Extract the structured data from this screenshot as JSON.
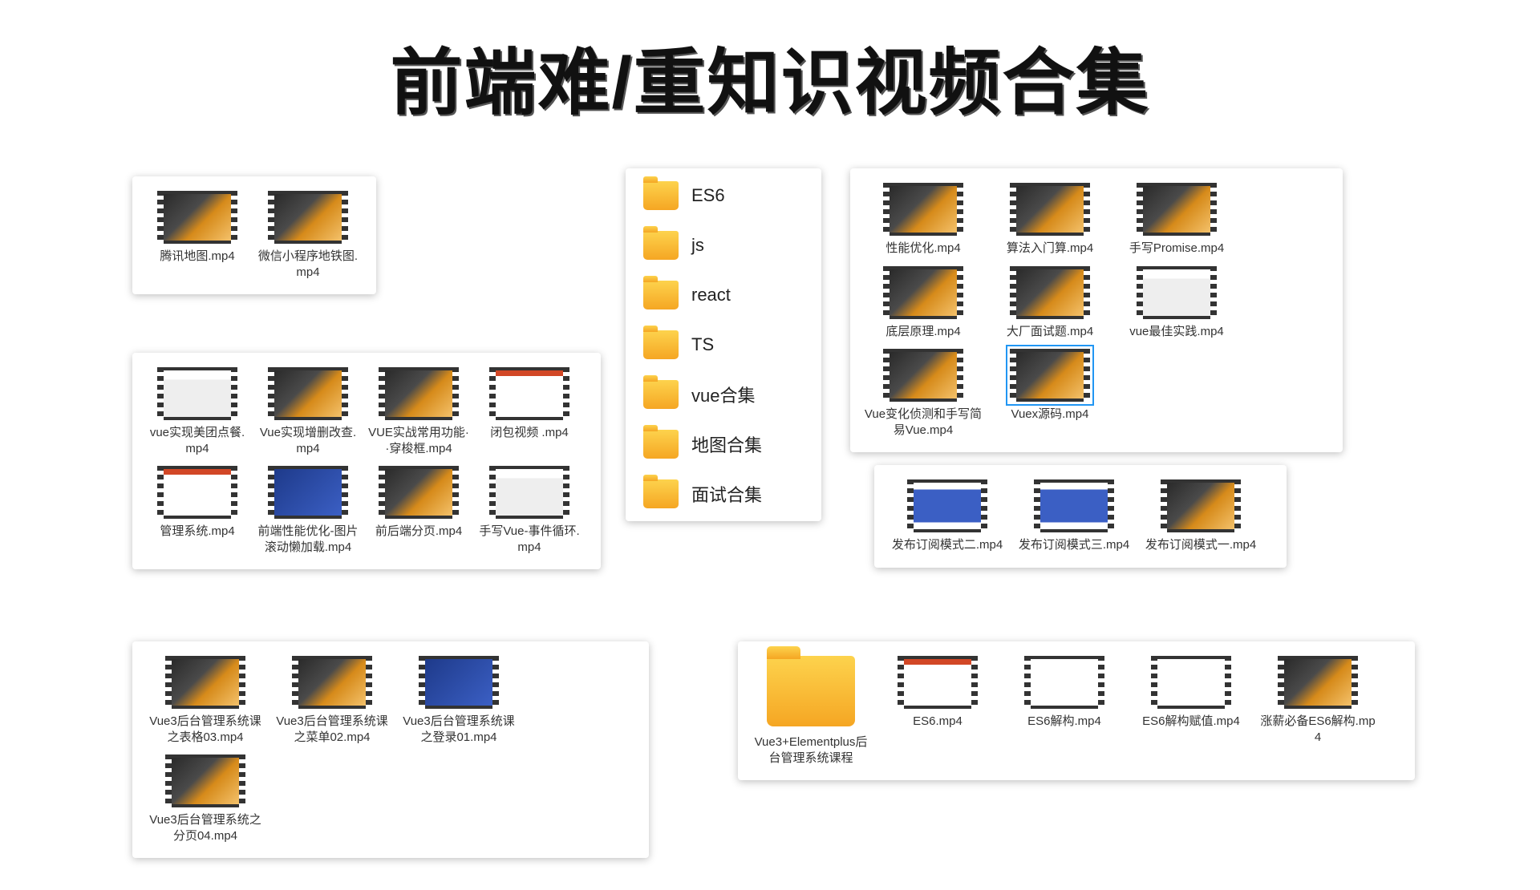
{
  "title": "前端难/重知识视频合集",
  "folders": [
    "ES6",
    "js",
    "react",
    "TS",
    "vue合集",
    "地图合集",
    "面试合集"
  ],
  "panel1": [
    {
      "name": "腾讯地图.mp4",
      "style": "default"
    },
    {
      "name": "微信小程序地铁图.mp4",
      "style": "default"
    }
  ],
  "panel3": [
    {
      "name": "vue实现美团点餐.mp4",
      "style": "code"
    },
    {
      "name": "Vue实现增删改查.mp4",
      "style": "default"
    },
    {
      "name": "VUE实战常用功能··穿梭框.mp4",
      "style": "default"
    },
    {
      "name": "闭包视频 .mp4",
      "style": "ppt"
    },
    {
      "name": "管理系统.mp4",
      "style": "ppt"
    },
    {
      "name": "前端性能优化-图片滚动懒加载.mp4",
      "style": "blue"
    },
    {
      "name": "前后端分页.mp4",
      "style": "default"
    },
    {
      "name": "手写Vue-事件循环.mp4",
      "style": "code"
    }
  ],
  "panel4": [
    {
      "name": "Vue3后台管理系统课之表格03.mp4",
      "style": "default"
    },
    {
      "name": "Vue3后台管理系统课之菜单02.mp4",
      "style": "default"
    },
    {
      "name": "Vue3后台管理系统课之登录01.mp4",
      "style": "blue"
    },
    {
      "name": "Vue3后台管理系统之分页04.mp4",
      "style": "default"
    }
  ],
  "panel5": [
    {
      "name": "性能优化.mp4",
      "style": "default"
    },
    {
      "name": "算法入门算.mp4",
      "style": "default"
    },
    {
      "name": "手写Promise.mp4",
      "style": "default"
    },
    {
      "name": "底层原理.mp4",
      "style": "default"
    },
    {
      "name": "大厂面试题.mp4",
      "style": "default"
    },
    {
      "name": "vue最佳实践.mp4",
      "style": "code"
    },
    {
      "name": "Vue变化侦测和手写简易Vue.mp4",
      "style": "default"
    },
    {
      "name": "Vuex源码.mp4",
      "style": "default",
      "selected": true
    }
  ],
  "panel6": [
    {
      "name": "发布订阅模式二.mp4",
      "style": "ppt-blue"
    },
    {
      "name": "发布订阅模式三.mp4",
      "style": "ppt-blue"
    },
    {
      "name": "发布订阅模式一.mp4",
      "style": "default"
    }
  ],
  "panel7_folder": "Vue3+Elementplus后台管理系统课程",
  "panel7": [
    {
      "name": "ES6.mp4",
      "style": "ppt"
    },
    {
      "name": "ES6解构.mp4",
      "style": "white"
    },
    {
      "name": "ES6解构赋值.mp4",
      "style": "white"
    },
    {
      "name": "涨薪必备ES6解构.mp4",
      "style": "default"
    }
  ]
}
